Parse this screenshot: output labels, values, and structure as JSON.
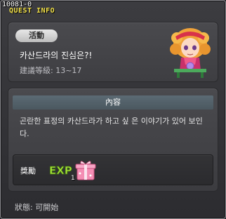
{
  "window": {
    "quest_id": "10081-0",
    "title": "QUEST INFO"
  },
  "quest": {
    "category_badge": "活動",
    "title": "카산드라의 진심은?!",
    "level_text": "建議等級: 13~17",
    "npc_icon": "cassandra-npc-portrait"
  },
  "content": {
    "header": "內容",
    "description": "곤란한 표정의 카산드라가 하고 싶 은 이야기가 있어 보인다."
  },
  "reward": {
    "label": "獎勵",
    "exp_icon": "exp-icon",
    "exp_text": "EXP",
    "item_icon": "gift-box-icon",
    "item_count": "1"
  },
  "footer": {
    "status": "狀態: 可開始"
  },
  "colors": {
    "title_yellow": "#f2e14a",
    "header_bar": "#56636c",
    "badge": "#d6d6d6",
    "exp_green": "#9be030",
    "gift_pink": "#f28ab0"
  }
}
